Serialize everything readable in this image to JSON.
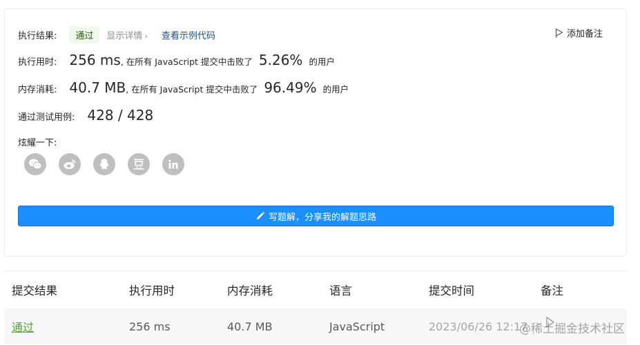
{
  "result": {
    "label": "执行结果:",
    "status": "通过",
    "detail_link": "显示详情",
    "code_link": "查看示例代码",
    "note_button": "添加备注"
  },
  "runtime": {
    "label": "执行用时:",
    "value": "256 ms",
    "text": ", 在所有 JavaScript 提交中击败了",
    "percent": "5.26%",
    "suffix": "的用户"
  },
  "memory": {
    "label": "内存消耗:",
    "value": "40.7 MB",
    "text": ", 在所有 JavaScript 提交中击败了",
    "percent": "96.49%",
    "suffix": "的用户"
  },
  "tests": {
    "label": "通过测试用例:",
    "value": "428 / 428"
  },
  "share": {
    "label": "炫耀一下:",
    "icons": [
      "wechat-icon",
      "weibo-icon",
      "qq-icon",
      "douban-icon",
      "linkedin-icon"
    ]
  },
  "write_button": "写题解，分享我的解题思路",
  "table": {
    "headers": [
      "提交结果",
      "执行用时",
      "内存消耗",
      "语言",
      "提交时间",
      "备注"
    ],
    "row": {
      "result": "通过",
      "runtime": "256 ms",
      "memory": "40.7 MB",
      "language": "JavaScript",
      "time": "2023/06/26 12:17"
    }
  },
  "watermark": "@稀土掘金技术社区",
  "colors": {
    "accent": "#1a90ff",
    "pass": "#52a52e",
    "link": "#1d4e89",
    "icon_gray": "#bfbfbf"
  }
}
